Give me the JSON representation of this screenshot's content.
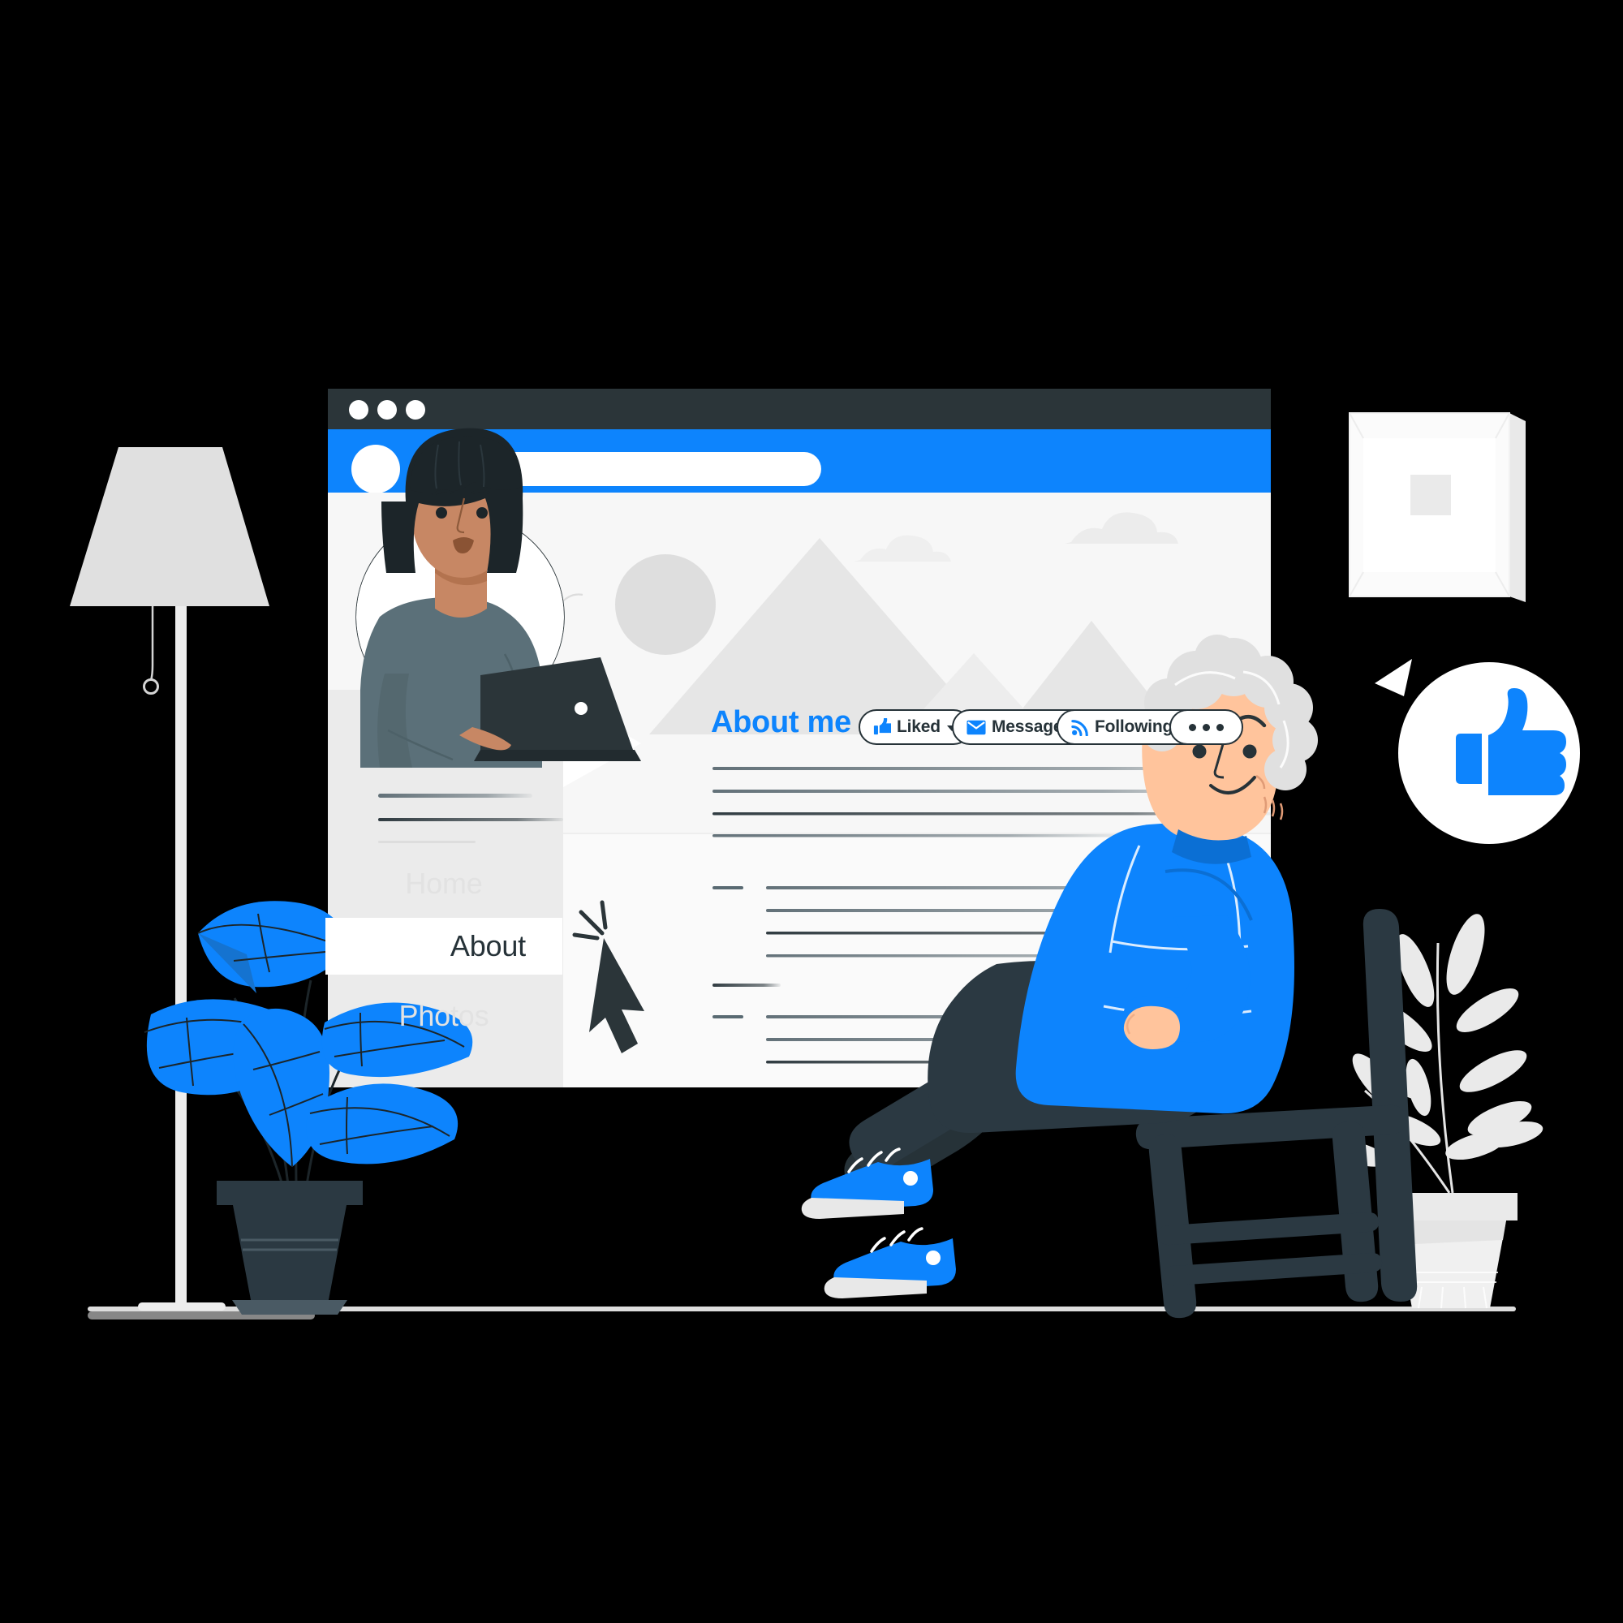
{
  "scene": {
    "title": "Social profile About page illustration",
    "background_color": "#000000",
    "accent_color": "#0d84fd",
    "dark_color": "#263238",
    "light_gray": "#e8e8e8",
    "floor_color": "#f7f7f7"
  },
  "browser": {
    "titlebar": {
      "color": "#2b3539",
      "dots": [
        "window-dot",
        "window-dot",
        "window-dot"
      ],
      "dot_color": "#ffffff"
    },
    "appbar": {
      "color": "#0d84fd",
      "avatar_icon": "user-avatar-circle",
      "search_placeholder": ""
    },
    "cover_photo": {
      "alt": "mountain landscape cover photo",
      "shapes": [
        "sun",
        "mountain",
        "mountain",
        "cloud",
        "cloud",
        "bird"
      ]
    }
  },
  "profile": {
    "avatar_alt": "woman with dark bob hair using a laptop",
    "name_placeholder": "",
    "subtitle_placeholder": ""
  },
  "sidebar": {
    "items": [
      {
        "label": "Home",
        "active": false
      },
      {
        "label": "About",
        "active": true
      },
      {
        "label": "Photos",
        "active": false
      }
    ]
  },
  "main": {
    "heading": "About me",
    "buttons": [
      {
        "label": "Liked",
        "icon": "thumbs-up-icon",
        "has_caret": true
      },
      {
        "label": "Message",
        "icon": "envelope-icon",
        "has_caret": true
      },
      {
        "label": "Following",
        "icon": "rss-icon",
        "has_caret": true
      },
      {
        "label": "",
        "icon": "ellipsis-icon",
        "has_caret": false
      }
    ],
    "body_placeholder_groups": [
      4,
      4,
      3
    ]
  },
  "cursor": {
    "icon": "mouse-pointer-click-icon",
    "color": "#263238"
  },
  "room": {
    "lamp": {
      "name": "floor-lamp",
      "shade_color": "#e0e0e0",
      "pole_color": "#ededed"
    },
    "plant_left": {
      "name": "blue-leaf-plant",
      "leaf_color": "#0d84fd",
      "pot_color": "#2b3942"
    },
    "plant_right": {
      "name": "white-leaf-plant",
      "leaf_color": "#e8e8e8",
      "pot_color": "#f0f0f0"
    },
    "wall_frame": {
      "name": "wall-picture-frame",
      "frame_color": "#fbfbfb",
      "inner_color": "#eaeaea"
    },
    "chair": {
      "name": "wooden-chair",
      "color": "#2b3942"
    }
  },
  "person": {
    "alt": "elderly man with white curly hair sitting on a chair with a laptop",
    "hair_color": "#e0e0e0",
    "skin_color": "#ffc49c",
    "sweater_color": "#0d84fd",
    "pants_color": "#263238",
    "shoes_color": "#0d84fd",
    "reaction_bubble": {
      "icon": "thumbs-up-icon",
      "color": "#0d84fd",
      "bubble_color": "#ffffff"
    }
  }
}
